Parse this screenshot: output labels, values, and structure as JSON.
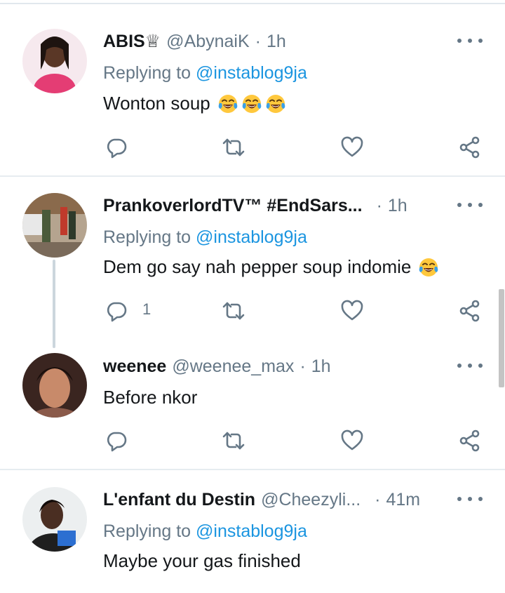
{
  "tweets": [
    {
      "name": "ABIS♕",
      "handle": "@AbynaiK",
      "time": "1h",
      "reply_prefix": "Replying to",
      "reply_to": "@instablog9ja",
      "text": "Wonton soup",
      "emoji_count": 3,
      "reply_count": ""
    },
    {
      "name": "PrankoverlordTV™ #EndSars...",
      "handle": "",
      "time": "1h",
      "reply_prefix": "Replying to",
      "reply_to": "@instablog9ja",
      "text": "Dem go say nah pepper soup indomie",
      "emoji_count": 1,
      "reply_count": "1"
    },
    {
      "name": "weenee",
      "handle": "@weenee_max",
      "time": "1h",
      "reply_prefix": "",
      "reply_to": "",
      "text": "Before nkor",
      "emoji_count": 0,
      "reply_count": ""
    },
    {
      "name": "L'enfant du Destin",
      "handle": "@Cheezyli...",
      "time": "41m",
      "reply_prefix": "Replying to",
      "reply_to": "@instablog9ja",
      "text": "Maybe your gas finished",
      "emoji_count": 0,
      "reply_count": ""
    }
  ],
  "separator": "·",
  "icons": {
    "reply": "reply-icon",
    "retweet": "retweet-icon",
    "like": "heart-icon",
    "share": "share-icon",
    "more": "more-icon",
    "emoji": "tears-of-joy-emoji"
  },
  "colors": {
    "link": "#1b95e0",
    "secondary": "#657786",
    "text": "#14171a"
  }
}
